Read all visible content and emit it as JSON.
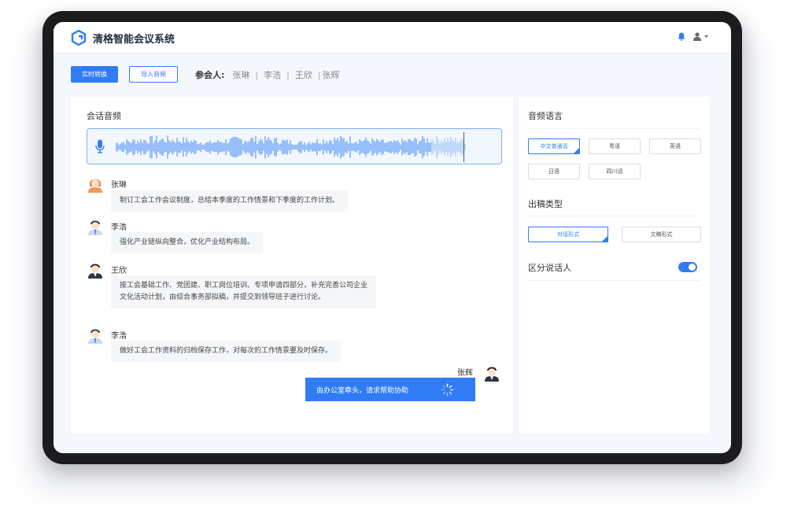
{
  "app": {
    "title": "清格智能会议系统"
  },
  "toolbar": {
    "realtime_label": "实时转换",
    "import_label": "导入音频",
    "participants_label": "参会人:",
    "participants": [
      "张琳",
      "李浩",
      "王欣",
      "张辉"
    ]
  },
  "left_panel": {
    "title": "会话音频"
  },
  "messages": [
    {
      "speaker": "张琳",
      "lines": [
        "制订工会工作会议制度，总结本季度的工作情景和下季度的工作计划。"
      ]
    },
    {
      "speaker": "李浩",
      "lines": [
        "强化产业链纵向整合，优化产业结构布局。"
      ]
    },
    {
      "speaker": "王欣",
      "lines": [
        "按工会基础工作、党团建、职工岗位培训、专项申请四部分，补充完善公司企业",
        "文化活动计划，由综合事务部拟稿，并提交到领导班子进行讨论。"
      ]
    },
    {
      "speaker": "李浩",
      "lines": [
        "做好工会工作资料的归档保存工作，对每次的工作情景要及时保存。"
      ]
    },
    {
      "speaker": "张辉",
      "lines": [
        "由办公室牵头，请求帮助协助"
      ]
    }
  ],
  "settings": {
    "language_title": "音频语言",
    "languages": [
      "中文普通话",
      "粤语",
      "英语",
      "日语",
      "四川话"
    ],
    "selected_language": "中文普通话",
    "output_title": "出稿类型",
    "outputs": [
      "对话形式",
      "文稿形式"
    ],
    "selected_output": "对话形式",
    "speaker_toggle_label": "区分说话人",
    "speaker_toggle_on": true
  },
  "colors": {
    "accent": "#2f7cf6",
    "panel_bg": "#f4f7fc",
    "bubble_bg": "#f5f6f8"
  }
}
